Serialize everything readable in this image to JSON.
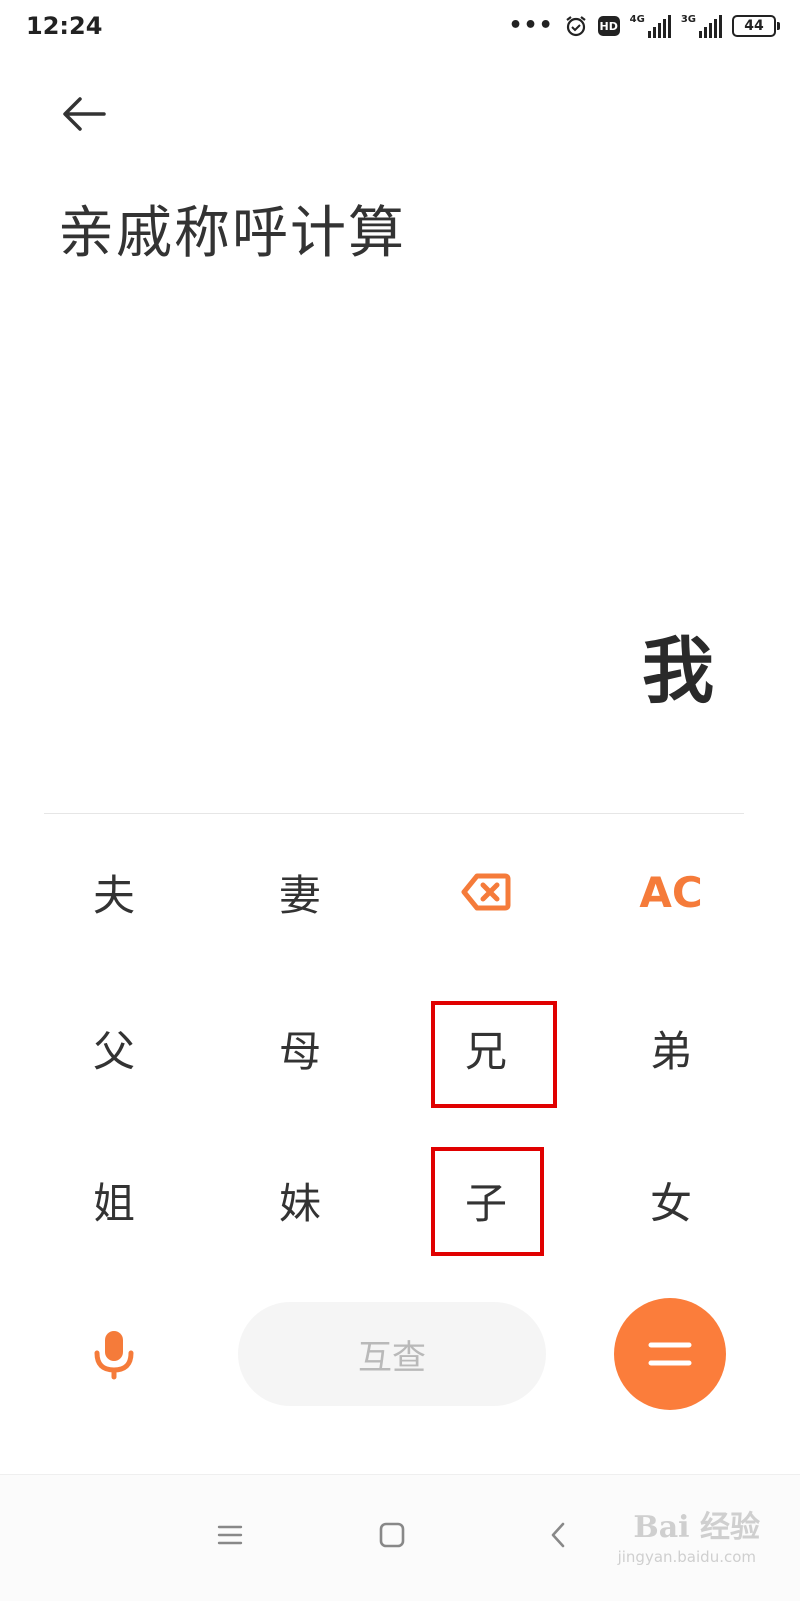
{
  "status_bar": {
    "time": "12:24",
    "network_1": "4G",
    "network_2": "3G",
    "battery": "44"
  },
  "header": {
    "title": "亲戚称呼计算"
  },
  "display": {
    "result": "我"
  },
  "keypad": {
    "row1": [
      "夫",
      "妻",
      "",
      "AC"
    ],
    "row2": [
      "父",
      "母",
      "兄",
      "弟"
    ],
    "row3": [
      "姐",
      "妹",
      "子",
      "女"
    ]
  },
  "bottom": {
    "query_label": "互查"
  },
  "watermark": {
    "brand": "Bai 经验",
    "site": "jingyan.baidu.com"
  },
  "colors": {
    "accent": "#fb7d3b",
    "highlight_box": "#e00000"
  }
}
